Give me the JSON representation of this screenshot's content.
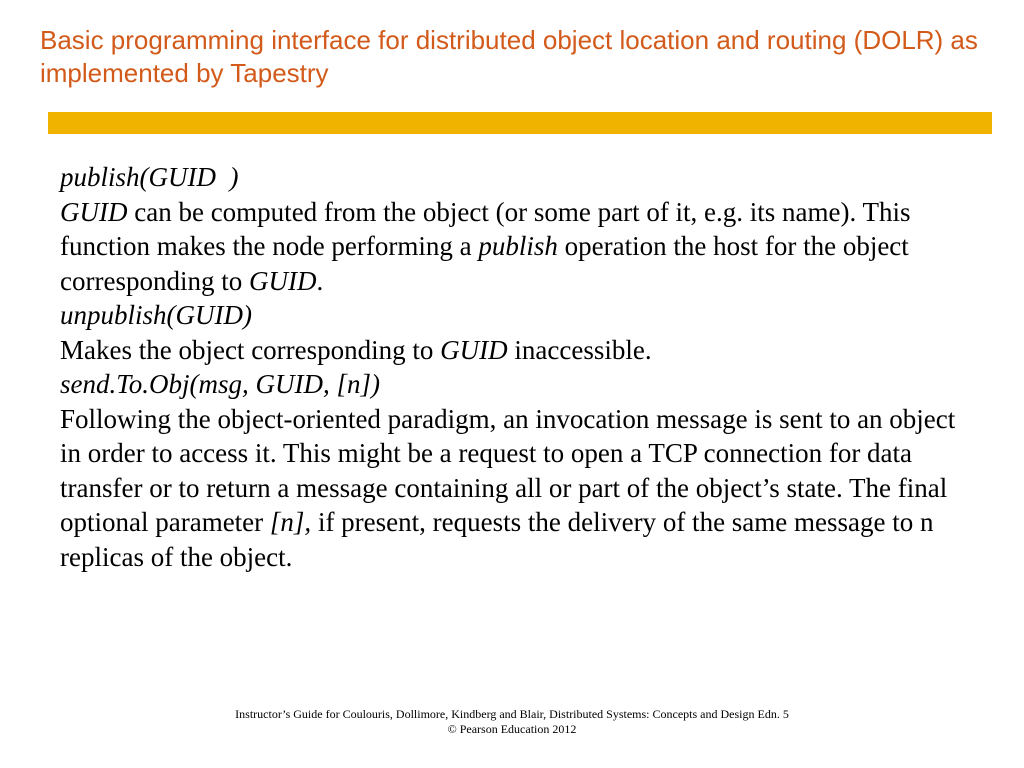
{
  "title": "Basic programming interface for distributed object location and routing (DOLR) as implemented by Tapestry",
  "entries": [
    {
      "sig": "publish(GUID  )",
      "desc_pre": "",
      "desc_i1": "GUID",
      "desc_mid1": " can be computed from the object (or some part of it, e.g. its name). This function makes the node performing a ",
      "desc_i2": "publish",
      "desc_mid2": " operation the host for the object corresponding to ",
      "desc_i3": "GUID",
      "desc_post": "."
    },
    {
      "sig": "unpublish(GUID)",
      "desc_pre": "Makes the object corresponding to ",
      "desc_i1": "GUID",
      "desc_mid1": " inaccessible.",
      "desc_i2": "",
      "desc_mid2": "",
      "desc_i3": "",
      "desc_post": ""
    },
    {
      "sig": "send.To.Obj(msg, GUID, [n])",
      "desc_pre": "Following the object-oriented paradigm, an invocation message is sent to an object in order to access it. This might be a request to open a TCP connection for data transfer or to return a message containing all or part of the object’s state. The final optional parameter ",
      "desc_i1": "[n],",
      "desc_mid1": " if present, requests the delivery of the same message to n replicas of the object.",
      "desc_i2": "",
      "desc_mid2": "",
      "desc_i3": "",
      "desc_post": ""
    }
  ],
  "footer": {
    "line1": "Instructor’s Guide for  Coulouris, Dollimore, Kindberg and Blair,  Distributed Systems: Concepts and Design   Edn. 5",
    "line2": "©  Pearson Education 2012"
  }
}
